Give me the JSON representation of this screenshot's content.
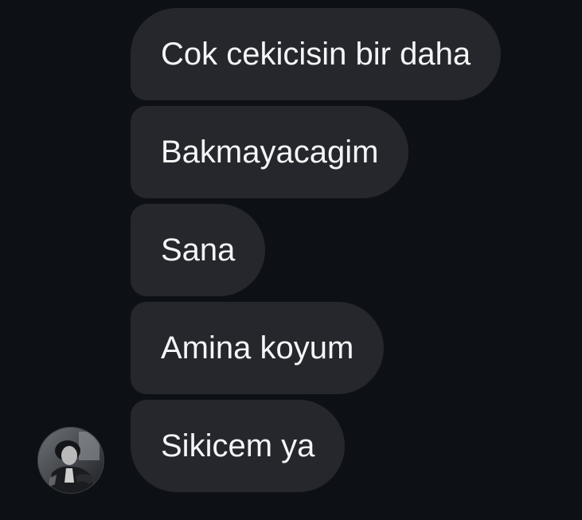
{
  "conversation": {
    "messages": [
      {
        "text": "Cok cekicisin bir daha"
      },
      {
        "text": "Bakmayacagim"
      },
      {
        "text": "Sana"
      },
      {
        "text": "Amina koyum"
      },
      {
        "text": "Sikicem ya"
      }
    ],
    "sender": {
      "avatar_icon": "profile-photo-avatar"
    }
  },
  "colors": {
    "background": "#0d1015",
    "bubble": "#25272c",
    "text": "#f4f5f7"
  }
}
